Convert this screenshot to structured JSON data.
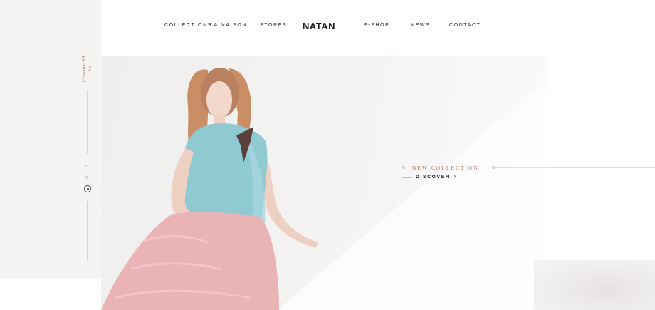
{
  "nav": {
    "collections": "COLLECTIONS",
    "la_maison": "LA MAISON",
    "stores": "STORES",
    "logo": "NATAN",
    "eshop": "E-SHOP",
    "news": "NEWS",
    "contact": "CONTACT"
  },
  "side": {
    "label": "Couture SS 16",
    "slides": 3,
    "active_slide": 3
  },
  "hero": {
    "tagline": "NEW COLLECTION",
    "cta": "DISCOVER",
    "cta_icon": "chevron-right-icon"
  },
  "colors": {
    "accent": "#b07a63",
    "top": "#8fc9d2",
    "skirt": "#eab3b6"
  }
}
